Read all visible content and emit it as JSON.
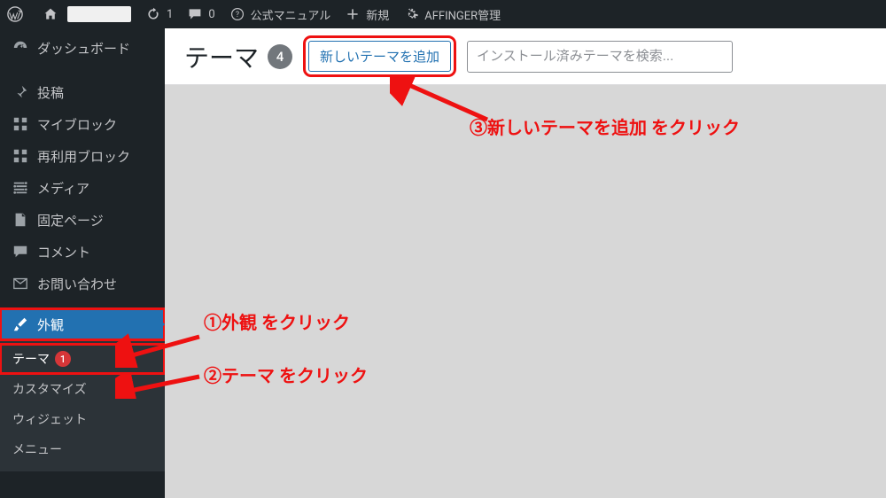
{
  "adminbar": {
    "updates_count": "1",
    "comments_count": "0",
    "manual_label": "公式マニュアル",
    "new_label": "新規",
    "affinger_label": "AFFINGER管理"
  },
  "sidebar": {
    "dashboard": "ダッシュボード",
    "posts": "投稿",
    "myblock": "マイブロック",
    "reusable": "再利用ブロック",
    "media": "メディア",
    "pages": "固定ページ",
    "comments": "コメント",
    "contact": "お問い合わせ",
    "appearance": "外観",
    "submenu": {
      "themes": "テーマ",
      "themes_badge": "1",
      "customize": "カスタマイズ",
      "widgets": "ウィジェット",
      "menus": "メニュー"
    }
  },
  "main": {
    "title": "テーマ",
    "count": "4",
    "add_new_label": "新しいテーマを追加",
    "search_placeholder": "インストール済みテーマを検索..."
  },
  "annotations": {
    "step1": "①外観 をクリック",
    "step2": "②テーマ をクリック",
    "step3": "③新しいテーマを追加 をクリック"
  }
}
